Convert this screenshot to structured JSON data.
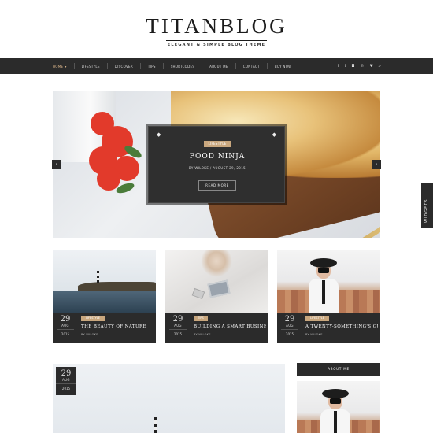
{
  "brand": {
    "title": "TITANBLOG",
    "tagline": "ELEGANT & SIMPLE BLOG THEME"
  },
  "nav": {
    "items": [
      {
        "label": "HOME",
        "active": true,
        "has_dropdown": true
      },
      {
        "label": "LIFESTYLE"
      },
      {
        "label": "DISCOVER"
      },
      {
        "label": "TIPS"
      },
      {
        "label": "SHORTCODES"
      },
      {
        "label": "ABOUT ME"
      },
      {
        "label": "CONTACT"
      },
      {
        "label": "BUY NOW"
      }
    ],
    "social_icons": [
      "facebook-icon",
      "twitter-icon",
      "instagram-icon",
      "pinterest-icon",
      "heart-icon"
    ],
    "search_icon": "search-icon"
  },
  "hero": {
    "category": "LIFESTYLE",
    "title": "FOOD NINJA",
    "byline": "BY WILOKE / AUGUST 29, 2015",
    "button": "READ MORE",
    "prev_icon": "chevron-left-icon",
    "next_icon": "chevron-right-icon"
  },
  "widgets_tab": "WIDGETS",
  "posts": [
    {
      "day": "29",
      "month": "AUG",
      "year": "2015",
      "category": "LIFESTYLE",
      "title": "THE BEAUTY OF NATURE",
      "author": "BY WILOKE"
    },
    {
      "day": "29",
      "month": "AUG",
      "year": "2015",
      "category": "TIPS",
      "title": "BUILDING A SMART BUSINESS",
      "author": "BY WILOKE"
    },
    {
      "day": "29",
      "month": "AUG",
      "year": "2015",
      "category": "LIFESTYLE",
      "title": "A TWENTY-SOMETHING'S GU…",
      "author": "BY WILOKE"
    }
  ],
  "featured": {
    "day": "29",
    "month": "AUG",
    "year": "2015"
  },
  "sidebar": {
    "heading": "ABOUT ME"
  },
  "colors": {
    "nav_bg": "#2b2b2b",
    "accent": "#c9a77e",
    "active_nav": "#d9b48a"
  }
}
